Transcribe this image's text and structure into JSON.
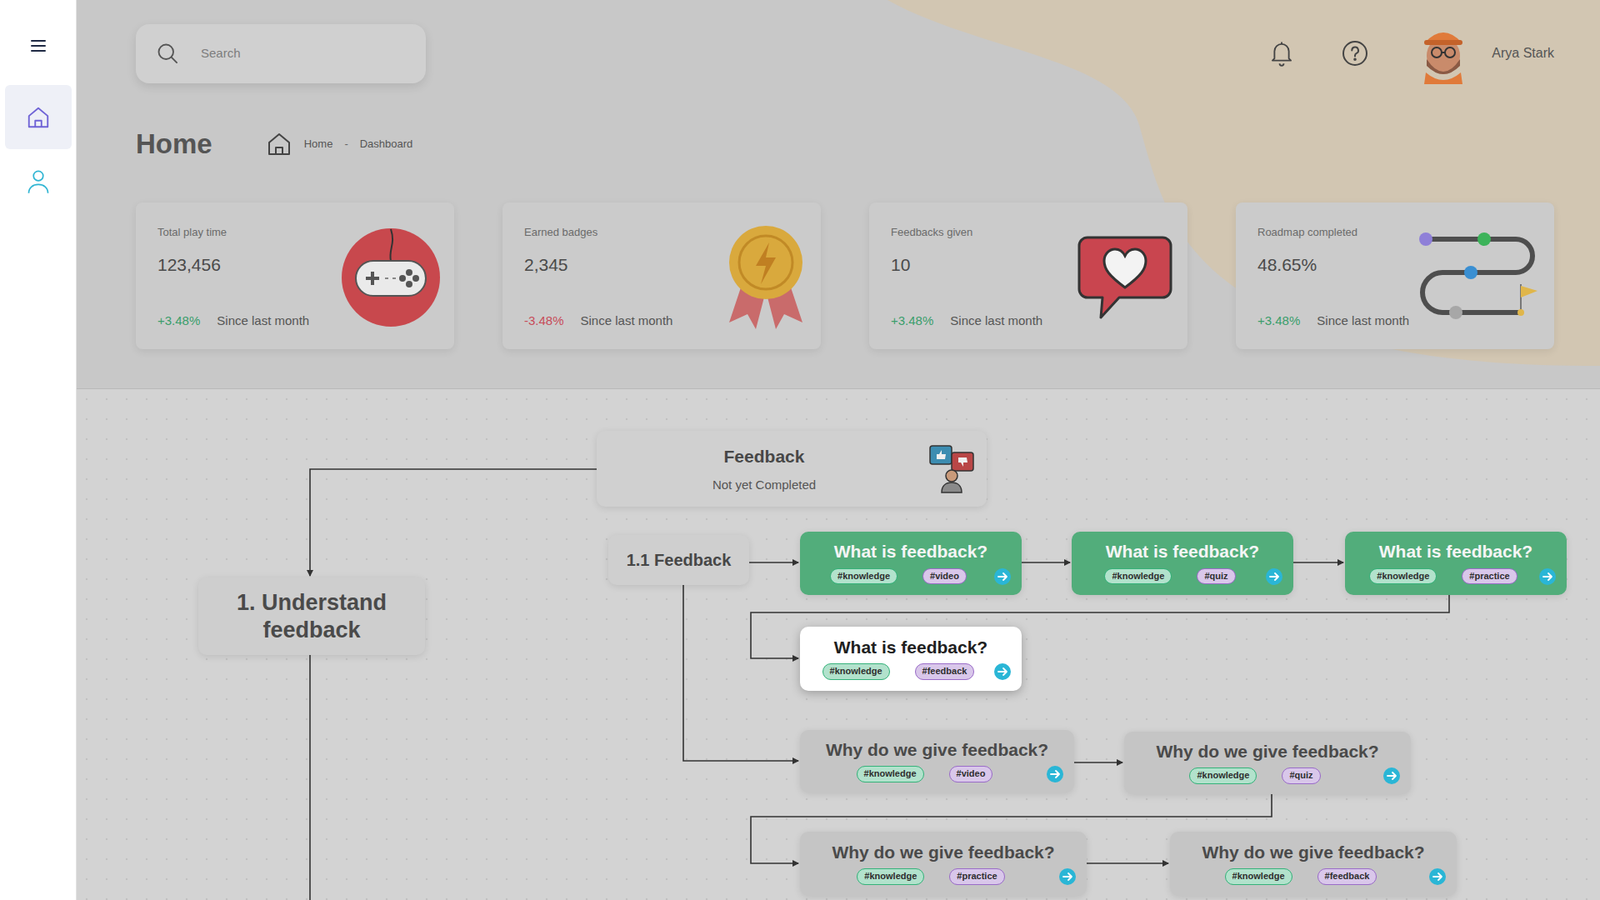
{
  "sidebar": {
    "items": [
      {
        "selected": true
      },
      {
        "selected": false
      }
    ]
  },
  "search": {
    "placeholder": "Search"
  },
  "user": {
    "name": "Arya Stark"
  },
  "page": {
    "title": "Home",
    "breadcrumb": {
      "items": [
        "Home",
        "Dashboard"
      ],
      "separator": "-"
    }
  },
  "stats": [
    {
      "label": "Total play time",
      "value": "123,456",
      "change": "+3.48%",
      "trend": "up",
      "note": "Since last month"
    },
    {
      "label": "Earned badges",
      "value": "2,345",
      "change": "-3.48%",
      "trend": "down",
      "note": "Since last month"
    },
    {
      "label": "Feedbacks given",
      "value": "10",
      "change": "+3.48%",
      "trend": "up",
      "note": "Since last month"
    },
    {
      "label": "Roadmap completed",
      "value": "48.65%",
      "change": "+3.48%",
      "trend": "up",
      "note": "Since last month"
    }
  ],
  "roadmap": {
    "topic": {
      "title": "Feedback",
      "status": "Not yet Completed"
    },
    "chapter": {
      "title": "1. Understand feedback"
    },
    "section": {
      "title": "1.1 Feedback"
    },
    "lessons": [
      {
        "title": "What is feedback?",
        "status": "completed",
        "tags": [
          {
            "label": "#knowledge",
            "color": "#35b27a"
          },
          {
            "label": "#video",
            "color": "#9a6cc8"
          }
        ]
      },
      {
        "title": "What is feedback?",
        "status": "completed",
        "tags": [
          {
            "label": "#knowledge",
            "color": "#35b27a"
          },
          {
            "label": "#quiz",
            "color": "#9a6cc8"
          }
        ]
      },
      {
        "title": "What is feedback?",
        "status": "completed",
        "tags": [
          {
            "label": "#knowledge",
            "color": "#35b27a"
          },
          {
            "label": "#practice",
            "color": "#9a6cc8"
          }
        ]
      },
      {
        "title": "What is feedback?",
        "status": "current",
        "tags": [
          {
            "label": "#knowledge",
            "color": "#35b27a"
          },
          {
            "label": "#feedback",
            "color": "#9a6cc8"
          }
        ]
      },
      {
        "title": "Why do we give feedback?",
        "status": "locked",
        "tags": [
          {
            "label": "#knowledge",
            "color": "#35b27a"
          },
          {
            "label": "#video",
            "color": "#9a6cc8"
          }
        ]
      },
      {
        "title": "Why do we give feedback?",
        "status": "locked",
        "tags": [
          {
            "label": "#knowledge",
            "color": "#35b27a"
          },
          {
            "label": "#quiz",
            "color": "#9a6cc8"
          }
        ]
      },
      {
        "title": "Why do we give feedback?",
        "status": "locked",
        "tags": [
          {
            "label": "#knowledge",
            "color": "#35b27a"
          },
          {
            "label": "#practice",
            "color": "#9a6cc8"
          }
        ]
      },
      {
        "title": "Why do we give feedback?",
        "status": "locked",
        "tags": [
          {
            "label": "#knowledge",
            "color": "#35b27a"
          },
          {
            "label": "#feedback",
            "color": "#9a6cc8"
          }
        ]
      }
    ]
  }
}
